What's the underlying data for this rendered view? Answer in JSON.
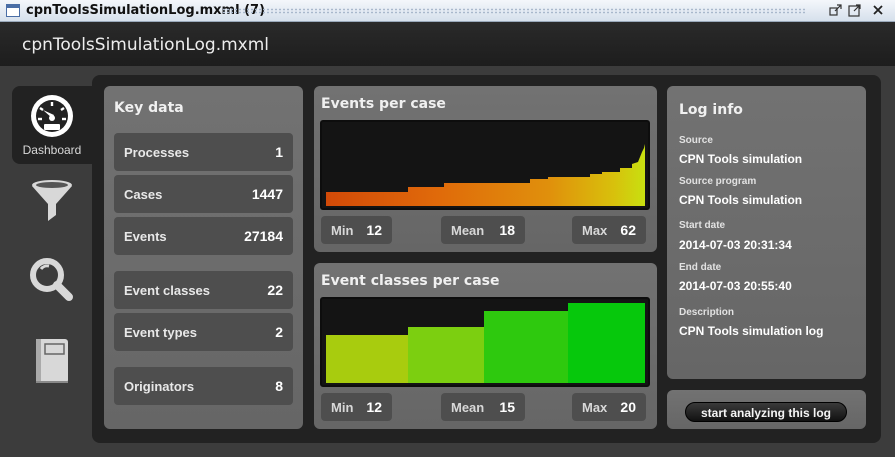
{
  "window": {
    "title": "cpnToolsSimulationLog.mxml (7)",
    "buttons": [
      "restore-icon",
      "maximize-icon",
      "close-icon"
    ]
  },
  "app": {
    "title": "cpnToolsSimulationLog.mxml"
  },
  "sidebar": {
    "tabs": [
      {
        "label": "Dashboard",
        "icon": "dashboard-gauge-icon",
        "active": true
      },
      {
        "label": "",
        "icon": "filter-funnel-icon",
        "active": false
      },
      {
        "label": "",
        "icon": "magnifier-icon",
        "active": false
      },
      {
        "label": "",
        "icon": "book-icon",
        "active": false
      }
    ]
  },
  "key_data": {
    "title": "Key data",
    "rows": [
      {
        "label": "Processes",
        "value": "1"
      },
      {
        "label": "Cases",
        "value": "1447"
      },
      {
        "label": "Events",
        "value": "27184"
      },
      {
        "label": "Event classes",
        "value": "22"
      },
      {
        "label": "Event types",
        "value": "2"
      },
      {
        "label": "Originators",
        "value": "8"
      }
    ]
  },
  "events_per_case": {
    "title": "Events per case",
    "min_label": "Min",
    "min": "12",
    "mean_label": "Mean",
    "mean": "18",
    "max_label": "Max",
    "max": "62"
  },
  "event_classes_per_case": {
    "title": "Event classes per case",
    "min_label": "Min",
    "min": "12",
    "mean_label": "Mean",
    "mean": "15",
    "max_label": "Max",
    "max": "20"
  },
  "log_info": {
    "title": "Log info",
    "fields": [
      {
        "label": "Source",
        "value": "CPN Tools simulation"
      },
      {
        "label": "Source program",
        "value": "CPN Tools simulation"
      },
      {
        "label": "Start date",
        "value": "2014-07-03 20:31:34"
      },
      {
        "label": "End date",
        "value": "2014-07-03 20:55:40"
      },
      {
        "label": "Description",
        "value": "CPN Tools simulation log"
      }
    ]
  },
  "actions": {
    "start_label": "start analyzing this log"
  },
  "colors": {
    "background": "#3c3c3c",
    "panel": "#6c6c6c",
    "row": "#4e4e4e",
    "chart_bg": "#141414"
  }
}
